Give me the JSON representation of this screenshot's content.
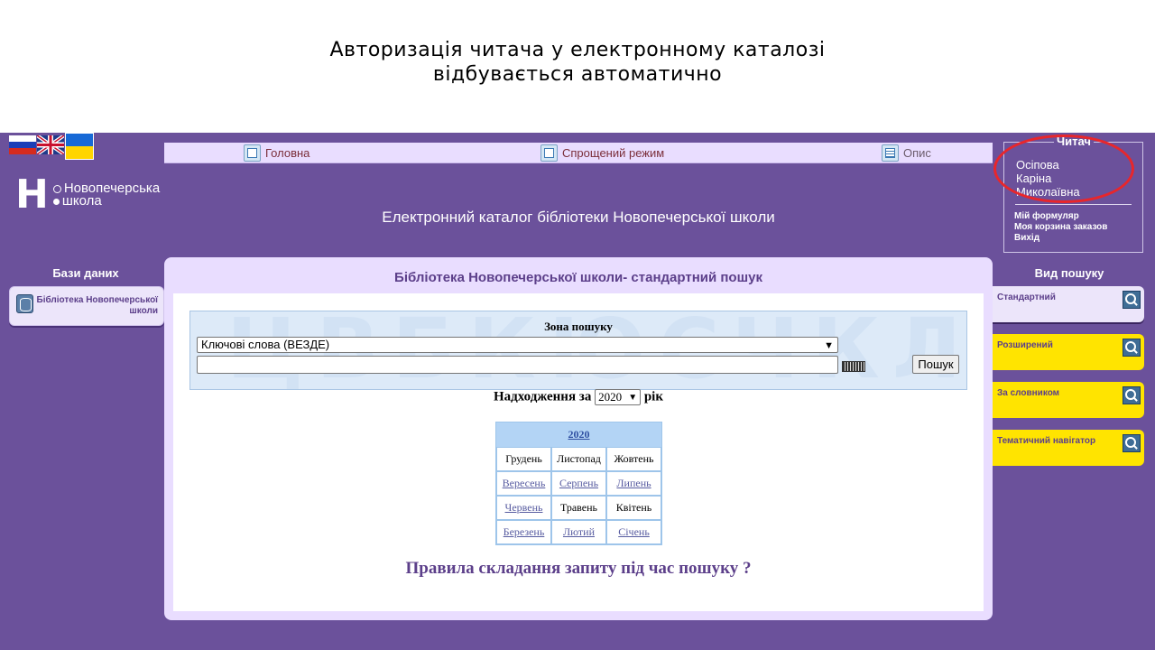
{
  "slide": {
    "title_line1": "Авторизація читача у електронному каталозі",
    "title_line2": "відбувається автоматично"
  },
  "logo": {
    "letter": "Н",
    "line1": "Новопечерська",
    "line2": "школа"
  },
  "nav": {
    "home": "Головна",
    "simple_mode": "Спрощений режим",
    "description": "Опис"
  },
  "catalog_title": "Електронний каталог бібліотеки Новопечерської школи",
  "reader": {
    "legend": "Читач",
    "surname": "Осіпова",
    "name": "Каріна",
    "patronymic": "Миколаївна",
    "links": [
      "Мій формуляр",
      "Моя корзина заказов",
      "Вихід"
    ]
  },
  "databases": {
    "heading": "Бази даних",
    "item_line1": "Бібліотека Новопечерської",
    "item_line2": "школи"
  },
  "main": {
    "title": "Бібліотека Новопечерської школи- стандартний пошук",
    "zone_label": "Зона пошуку",
    "zone_selected": "Ключові слова (ВЕЗДЕ)",
    "search_button": "Пошук",
    "arrivals_prefix": "Надходження за",
    "arrivals_year": "2020",
    "arrivals_suffix": "рік",
    "rules": "Правила складання запиту під час пошуку ?"
  },
  "calendar": {
    "year": "2020",
    "rows": [
      [
        {
          "label": "Грудень",
          "link": false
        },
        {
          "label": "Листопад",
          "link": false
        },
        {
          "label": "Жовтень",
          "link": false
        }
      ],
      [
        {
          "label": "Вересень",
          "link": true
        },
        {
          "label": "Серпень",
          "link": true
        },
        {
          "label": "Липень",
          "link": true
        }
      ],
      [
        {
          "label": "Червень",
          "link": true
        },
        {
          "label": "Травень",
          "link": false
        },
        {
          "label": "Квітень",
          "link": false
        }
      ],
      [
        {
          "label": "Березень",
          "link": true
        },
        {
          "label": "Лютий",
          "link": true
        },
        {
          "label": "Січень",
          "link": true
        }
      ]
    ]
  },
  "search_types": {
    "heading": "Вид пошуку",
    "items": [
      "Стандартний",
      "Розширений",
      "За словником",
      "Тематичний навігатор"
    ]
  },
  "colors": {
    "background": "#6b519b",
    "panel": "#e9ddff",
    "accent_yellow": "#ffe400",
    "highlight_red": "#e8262b"
  }
}
